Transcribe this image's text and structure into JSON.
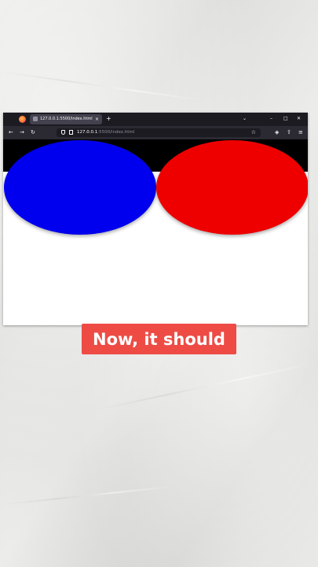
{
  "browser": {
    "tab": {
      "title": "127.0.0.1:5500/index.html",
      "close_glyph": "×"
    },
    "new_tab_glyph": "+",
    "window_controls": {
      "list_glyph": "⌄",
      "minimize_glyph": "–",
      "maximize_glyph": "□",
      "close_glyph": "✕"
    },
    "nav": {
      "back_glyph": "←",
      "forward_glyph": "→",
      "reload_glyph": "↻"
    },
    "url": {
      "host": "127.0.0.1",
      "rest": ":5500/index.html"
    },
    "bookmark_glyph": "☆",
    "toolbar_glyphs": {
      "pocket": "◈",
      "extensions": "⇧",
      "menu": "≡"
    }
  },
  "page": {
    "ellipses": [
      {
        "name": "blue",
        "color": "#0000ee"
      },
      {
        "name": "red",
        "color": "#ee0000"
      }
    ],
    "band_color": "#000000"
  },
  "caption": {
    "text": "Now, it should",
    "background": "#ee4b45"
  }
}
